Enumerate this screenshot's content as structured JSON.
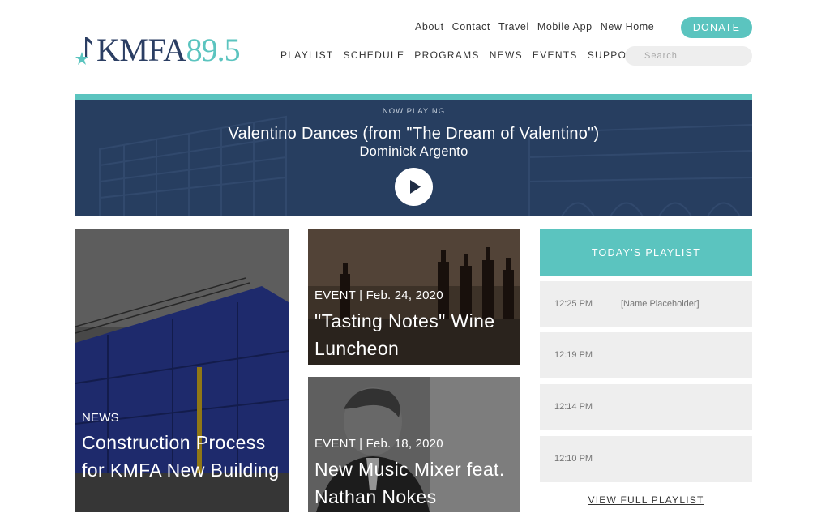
{
  "brand": {
    "logo_text": "KMFA",
    "logo_number": "89.5",
    "colors": {
      "navy": "#2b3e63",
      "teal": "#5bc4bf"
    }
  },
  "utility_nav": [
    "About",
    "Contact",
    "Travel",
    "Mobile App",
    "New Home"
  ],
  "donate_label": "DONATE",
  "main_nav": [
    "PLAYLIST",
    "SCHEDULE",
    "PROGRAMS",
    "NEWS",
    "EVENTS",
    "SUPPORT"
  ],
  "search": {
    "placeholder": "Search"
  },
  "now_playing": {
    "label": "NOW PLAYING",
    "title": "Valentino Dances (from \"The Dream of Valentino\")",
    "artist": "Dominick Argento",
    "play_icon": "play-icon"
  },
  "cards": [
    {
      "kicker": "NEWS",
      "headline": "Construction Process for KMFA New Building"
    },
    {
      "kicker": "EVENT | Feb. 24, 2020",
      "headline": "\"Tasting Notes\" Wine Luncheon"
    },
    {
      "kicker": "EVENT | Feb. 18, 2020",
      "headline": "New Music Mixer feat. Nathan Nokes"
    }
  ],
  "playlist": {
    "heading": "TODAY'S PLAYLIST",
    "rows": [
      {
        "time": "12:25 PM",
        "name": "[Name Placeholder]"
      },
      {
        "time": "12:19 PM",
        "name": ""
      },
      {
        "time": "12:14 PM",
        "name": ""
      },
      {
        "time": "12:10 PM",
        "name": ""
      }
    ],
    "view_full_label": "VIEW FULL PLAYLIST"
  }
}
